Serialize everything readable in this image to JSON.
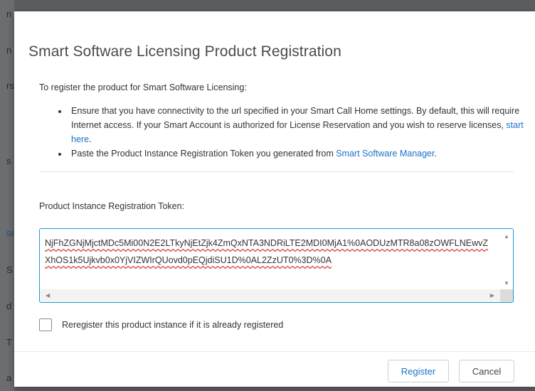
{
  "background": {
    "chars": [
      "n",
      "n",
      "rs",
      "s",
      "se",
      "S",
      "d",
      "T",
      "a"
    ]
  },
  "dialog": {
    "title": "Smart Software Licensing Product Registration",
    "intro": "To register the product for Smart Software Licensing:",
    "bullet1_text": "Ensure that you have connectivity to the url specified in your Smart Call Home settings. By default, this will require Internet access. If your Smart Account is authorized for License Reservation and you wish to reserve licenses, ",
    "bullet1_link": "start here",
    "bullet1_end": ".",
    "bullet2_text": "Paste the Product Instance Registration Token you generated from ",
    "bullet2_link": "Smart Software Manager",
    "bullet2_end": ".",
    "token_label": "Product Instance Registration Token:",
    "token_value": "NjFhZGNjMjctMDc5Mi00N2E2LTkyNjEtZjk4ZmQxNTA3NDRiLTE2MDI0MjA1%0AODUzMTR8a08zOWFLNEwvZXhOS1k5Ujkvb0x0YjVIZWIrQUovd0pEQjdiSU1D%0AL2ZzUT0%3D%0A",
    "checkbox_label": "Reregister this product instance if it is already registered",
    "checkbox_checked": false,
    "register_label": "Register",
    "cancel_label": "Cancel"
  },
  "colors": {
    "link": "#1a73c5",
    "input_border": "#1a9bd6",
    "overlay": "#5d5f63"
  }
}
